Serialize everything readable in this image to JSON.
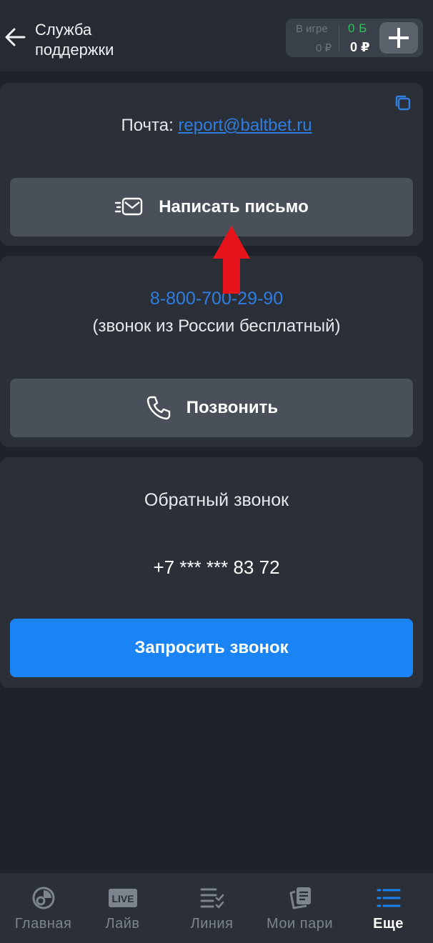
{
  "header": {
    "title": "Служба поддержки",
    "balance": {
      "in_game_label": "В игре",
      "in_game_value": "0 ₽",
      "bonus": "0 Б",
      "rubles": "0 ₽"
    }
  },
  "email_card": {
    "label": "Почта:",
    "email": "report@baltbet.ru",
    "button_label": "Написать письмо"
  },
  "phone_card": {
    "phone": "8-800-700-29-90",
    "note": "(звонок из России бесплатный)",
    "button_label": "Позвонить"
  },
  "callback_card": {
    "title": "Обратный звонок",
    "phone": "+7 *** *** 83 72",
    "button_label": "Запросить звонок"
  },
  "tabbar": {
    "items": [
      {
        "label": "Главная",
        "icon": "home-ball-icon"
      },
      {
        "label": "Лайв",
        "icon": "live-icon"
      },
      {
        "label": "Линия",
        "icon": "line-list-icon"
      },
      {
        "label": "Мои пари",
        "icon": "my-bets-icon"
      },
      {
        "label": "Еще",
        "icon": "more-menu-icon"
      }
    ],
    "active_index": 4
  },
  "colors": {
    "accent": "#1a84f5",
    "link": "#2f7de0",
    "bonus": "#2fbf5b",
    "annotation_arrow": "#e8141b"
  }
}
